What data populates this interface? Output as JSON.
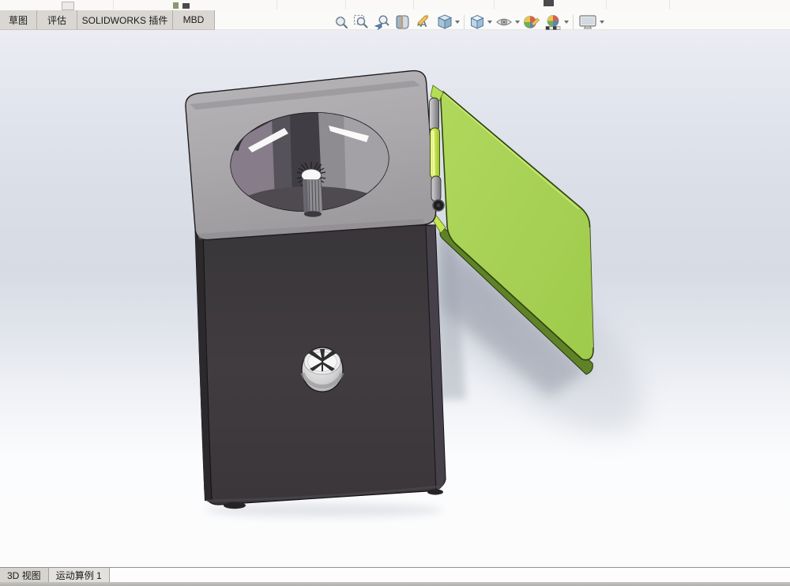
{
  "ribbon": {
    "tabs": [
      {
        "label": "草图"
      },
      {
        "label": "评估"
      },
      {
        "label": "SOLIDWORKS 插件"
      },
      {
        "label": "MBD"
      }
    ]
  },
  "headsup_toolbar": {
    "items": [
      {
        "icon": "zoom-to-fit-icon",
        "dropdown": false
      },
      {
        "icon": "zoom-to-area-icon",
        "dropdown": false
      },
      {
        "icon": "previous-view-icon",
        "dropdown": false
      },
      {
        "icon": "section-view-icon",
        "dropdown": false
      },
      {
        "icon": "annotation-views-icon",
        "dropdown": false
      },
      {
        "icon": "view-orientation-icon",
        "dropdown": true
      },
      {
        "icon": "display-style-icon",
        "dropdown": true
      },
      {
        "icon": "hide-show-items-icon",
        "dropdown": true
      },
      {
        "icon": "edit-appearance-icon",
        "dropdown": false
      },
      {
        "icon": "apply-scene-icon",
        "dropdown": true
      },
      {
        "icon": "view-settings-icon",
        "dropdown": true
      }
    ]
  },
  "viewport_model": {
    "description": "3D assembly of a pencil-sharpener style box: dark body, gray top plate with circular opening and milling cutter inside, yellow-green lid open on a hinge, screw on front face",
    "colors": {
      "lid_green": "#a7d155",
      "hinge_bright_green": "#c9e54a",
      "body_dark": "#3e3a3d",
      "body_side": "#46404a",
      "plate_gray": "#abaaad",
      "background_top": "#ecedf3",
      "background_mid": "#d7dbe4",
      "background_bottom": "#fcfcfd"
    }
  },
  "bottom_bar": {
    "tabs": [
      {
        "label": "3D 视图",
        "active": false
      },
      {
        "label": "运动算例 1",
        "active": true
      }
    ]
  }
}
